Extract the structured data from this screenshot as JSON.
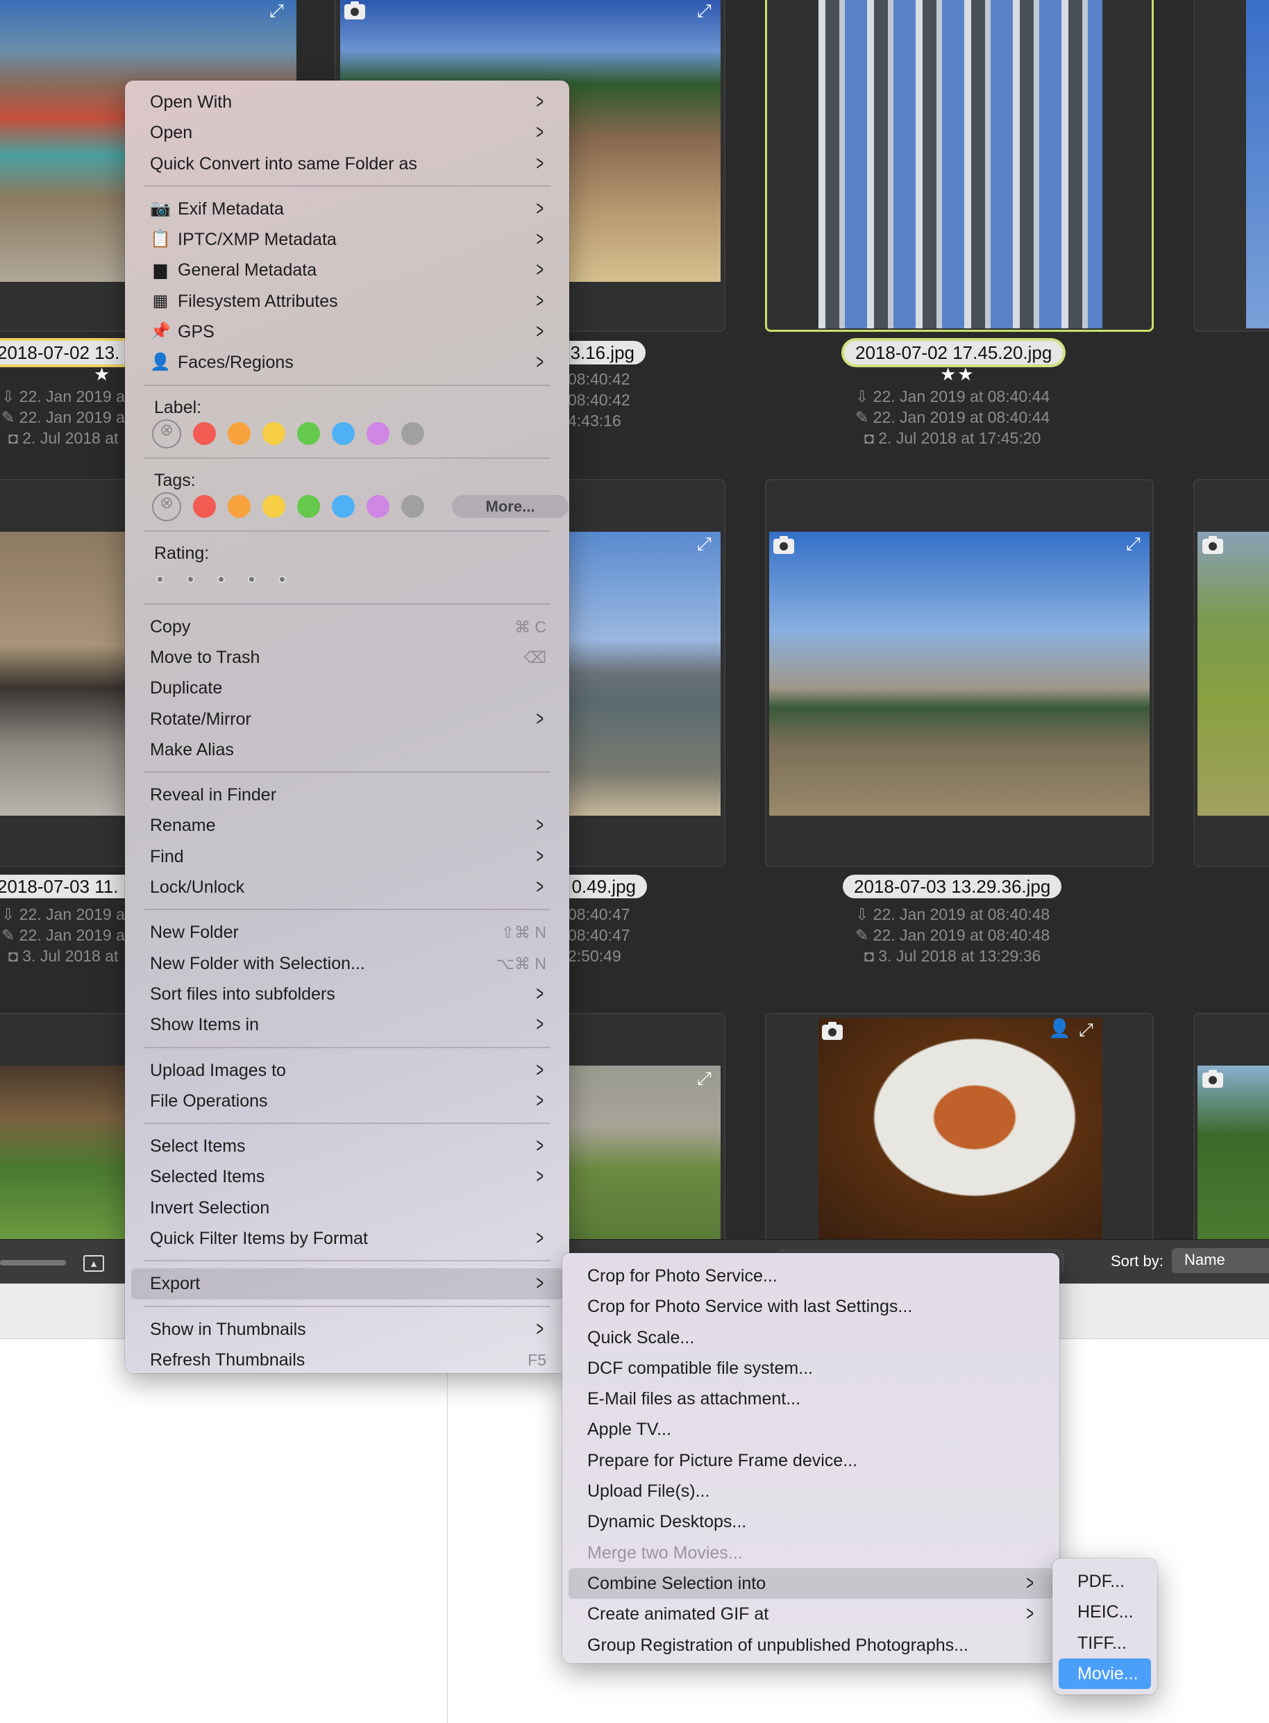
{
  "thumbnails": {
    "row1": {
      "col1": {
        "label": "2018-07-02 13.",
        "stars": "★",
        "meta": [
          "22. Jan 2019 a",
          "22. Jan 2019 a",
          "2. Jul 2018 at"
        ]
      },
      "col2": {
        "label": "3.16.jpg",
        "meta": [
          "08:40:42",
          "08:40:42",
          "4:43:16"
        ]
      },
      "col3": {
        "label": "2018-07-02 17.45.20.jpg",
        "stars": "★★",
        "meta": [
          "22. Jan 2019 at 08:40:44",
          "22. Jan 2019 at 08:40:44",
          "2. Jul 2018 at 17:45:20"
        ],
        "selected": true
      }
    },
    "row2": {
      "col1": {
        "label": "2018-07-03 11.",
        "meta": [
          "22. Jan 2019 a",
          "22. Jan 2019 a",
          "3. Jul 2018 at"
        ]
      },
      "col2": {
        "label": "0.49.jpg",
        "meta": [
          "08:40:47",
          "08:40:47",
          "2:50:49"
        ]
      },
      "col3": {
        "label": "2018-07-03 13.29.36.jpg",
        "meta": [
          "22. Jan 2019 at 08:40:48",
          "22. Jan 2019 at 08:40:48",
          "3. Jul 2018 at 13:29:36"
        ]
      }
    }
  },
  "toolbar": {
    "sort_label": "Sort by:",
    "sort_value": "Name"
  },
  "colors": {
    "selection": "#c9df6a",
    "highlight": "#4a9ffb",
    "label_colors": [
      "#f25a52",
      "#f7a23c",
      "#f6cf44",
      "#64c94d",
      "#4eb1f6",
      "#cf86e4",
      "#a0a0a0"
    ]
  },
  "main_menu": [
    {
      "type": "item",
      "label": "Open With",
      "arrow": true
    },
    {
      "type": "item",
      "label": "Open",
      "arrow": true
    },
    {
      "type": "item",
      "label": "Quick Convert into same Folder as",
      "arrow": true
    },
    {
      "type": "sep"
    },
    {
      "type": "item",
      "label": "Exif Metadata",
      "icon": "camera-icon",
      "glyph": "📷",
      "arrow": true
    },
    {
      "type": "item",
      "label": "IPTC/XMP Metadata",
      "icon": "clipboard-icon",
      "glyph": "📋",
      "arrow": true
    },
    {
      "type": "item",
      "label": "General Metadata",
      "icon": "archive-box-icon",
      "glyph": "▆",
      "arrow": true
    },
    {
      "type": "item",
      "label": "Filesystem Attributes",
      "icon": "calendar-icon",
      "glyph": "▦",
      "arrow": true
    },
    {
      "type": "item",
      "label": "GPS",
      "icon": "pushpin-icon",
      "glyph": "📌",
      "arrow": true
    },
    {
      "type": "item",
      "label": "Faces/Regions",
      "icon": "person-icon",
      "glyph": "👤",
      "arrow": true
    },
    {
      "type": "sep"
    },
    {
      "type": "colors",
      "label": "Label:"
    },
    {
      "type": "sep"
    },
    {
      "type": "colors",
      "label": "Tags:",
      "more": "More..."
    },
    {
      "type": "sep"
    },
    {
      "type": "rating",
      "label": "Rating:",
      "value": 0,
      "max": 5
    },
    {
      "type": "sep"
    },
    {
      "type": "item",
      "label": "Copy",
      "shortcut": "⌘ C"
    },
    {
      "type": "item",
      "label": "Move to Trash",
      "shortcut": "⌫"
    },
    {
      "type": "item",
      "label": "Duplicate"
    },
    {
      "type": "item",
      "label": "Rotate/Mirror",
      "arrow": true
    },
    {
      "type": "item",
      "label": "Make Alias"
    },
    {
      "type": "sep"
    },
    {
      "type": "item",
      "label": "Reveal in Finder"
    },
    {
      "type": "item",
      "label": "Rename",
      "arrow": true
    },
    {
      "type": "item",
      "label": "Find",
      "arrow": true
    },
    {
      "type": "item",
      "label": "Lock/Unlock",
      "arrow": true
    },
    {
      "type": "sep"
    },
    {
      "type": "item",
      "label": "New Folder",
      "shortcut": "⇧⌘ N"
    },
    {
      "type": "item",
      "label": "New Folder with Selection...",
      "shortcut": "⌥⌘ N"
    },
    {
      "type": "item",
      "label": "Sort files into subfolders",
      "arrow": true
    },
    {
      "type": "item",
      "label": "Show Items in",
      "arrow": true
    },
    {
      "type": "sep"
    },
    {
      "type": "item",
      "label": "Upload Images to",
      "arrow": true
    },
    {
      "type": "item",
      "label": "File Operations",
      "arrow": true
    },
    {
      "type": "sep"
    },
    {
      "type": "item",
      "label": "Select Items",
      "arrow": true
    },
    {
      "type": "item",
      "label": "Selected Items",
      "arrow": true
    },
    {
      "type": "item",
      "label": "Invert Selection"
    },
    {
      "type": "item",
      "label": "Quick Filter Items by Format",
      "arrow": true
    },
    {
      "type": "sep"
    },
    {
      "type": "item",
      "label": "Export",
      "arrow": true,
      "highlighted": true
    },
    {
      "type": "sep"
    },
    {
      "type": "item",
      "label": "Show in Thumbnails",
      "arrow": true
    },
    {
      "type": "item",
      "label": "Refresh Thumbnails",
      "shortcut": "F5"
    }
  ],
  "export_menu": [
    {
      "type": "item",
      "label": "Crop for Photo Service..."
    },
    {
      "type": "item",
      "label": "Crop for Photo Service with last Settings..."
    },
    {
      "type": "item",
      "label": "Quick Scale..."
    },
    {
      "type": "item",
      "label": "DCF compatible file system..."
    },
    {
      "type": "item",
      "label": "E-Mail files as attachment..."
    },
    {
      "type": "item",
      "label": "Apple TV..."
    },
    {
      "type": "item",
      "label": "Prepare for Picture Frame device..."
    },
    {
      "type": "item",
      "label": "Upload File(s)..."
    },
    {
      "type": "item",
      "label": "Dynamic Desktops..."
    },
    {
      "type": "item",
      "label": "Merge two Movies...",
      "disabled": true
    },
    {
      "type": "item",
      "label": "Combine Selection into",
      "arrow": true,
      "highlighted": true
    },
    {
      "type": "item",
      "label": "Create animated GIF at",
      "arrow": true
    },
    {
      "type": "item",
      "label": "Group Registration of unpublished Photographs..."
    }
  ],
  "combine_menu": [
    {
      "type": "item",
      "label": "PDF..."
    },
    {
      "type": "item",
      "label": "HEIC..."
    },
    {
      "type": "item",
      "label": "TIFF..."
    },
    {
      "type": "item",
      "label": "Movie...",
      "selected": true
    }
  ]
}
